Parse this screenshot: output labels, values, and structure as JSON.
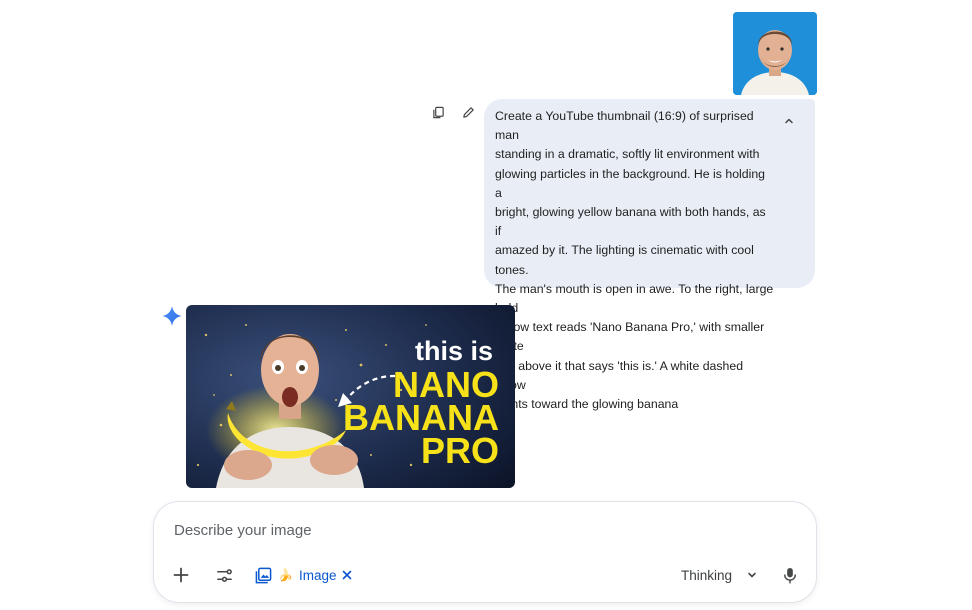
{
  "user_message": {
    "prompt": "Create a YouTube thumbnail (16:9) of surprised man\nstanding in a dramatic, softly lit environment with\nglowing particles in the background. He is holding a\nbright, glowing yellow banana with both hands, as if\namazed by it. The lighting is cinematic with cool tones.\nThe man's mouth is open in awe. To the right, large bold\nyellow text reads 'Nano Banana Pro,' with smaller white\ntext above it that says 'this is.' A white dashed arrow\npoints toward the glowing banana",
    "icons": {
      "copy": "copy-icon",
      "edit": "pencil-icon",
      "collapse": "chevron-up-icon"
    }
  },
  "response": {
    "icon": "gemini-sparkle-icon",
    "thumbnail": {
      "small_text": "this is",
      "line1": "NANO",
      "line2": "BANANA",
      "line3": "PRO"
    }
  },
  "composer": {
    "placeholder": "Describe your image",
    "chip": {
      "emoji": "🍌",
      "label": "Image"
    },
    "mode": "Thinking",
    "icons": {
      "add": "plus-icon",
      "tools": "tune-icon",
      "chip": "image-gallery-icon",
      "chip_close": "close-icon",
      "mode": "chevron-down-icon",
      "mic": "microphone-icon"
    }
  },
  "colors": {
    "bubble": "#e9eef6",
    "accent_blue": "#0b57d0",
    "banana_yellow": "#f7e21a"
  }
}
